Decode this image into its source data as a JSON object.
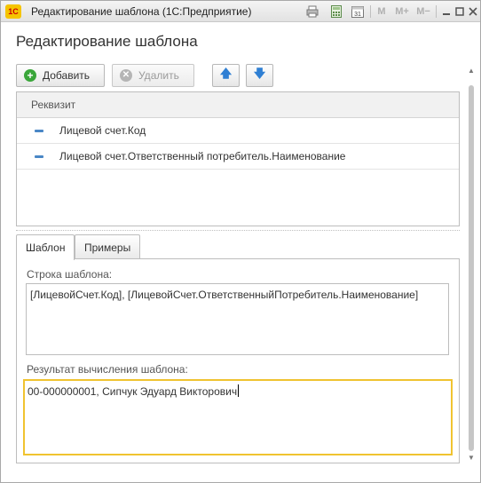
{
  "window": {
    "app_logo": "1С",
    "title": "Редактирование шаблона  (1С:Предприятие)",
    "toolbar_icons": [
      "print-icon",
      "calculator-icon",
      "calendar-icon"
    ],
    "memory_buttons": [
      "M",
      "M+",
      "M−"
    ],
    "window_buttons": [
      "minimize-icon",
      "maximize-icon",
      "close-icon"
    ]
  },
  "form": {
    "title": "Редактирование шаблона"
  },
  "toolbar": {
    "add_label": "Добавить",
    "delete_label": "Удалить"
  },
  "table": {
    "column_header": "Реквизит",
    "rows": [
      "Лицевой счет.Код",
      "Лицевой счет.Ответственный потребитель.Наименование"
    ]
  },
  "tabs": [
    {
      "label": "Шаблон",
      "active": true
    },
    {
      "label": "Примеры",
      "active": false
    }
  ],
  "template_tab": {
    "template_label": "Строка шаблона:",
    "template_value": "[ЛицевойСчет.Код], [ЛицевойСчет.ОтветственныйПотребитель.Наименование]",
    "result_label": "Результат вычисления шаблона:",
    "result_value": "00-000000001, Сипчук Эдуард Викторович"
  },
  "colors": {
    "accent_focus": "#f0c330",
    "add_icon": "#3aa63a",
    "arrow": "#2f7fd3",
    "row_marker": "#4a87c6"
  }
}
